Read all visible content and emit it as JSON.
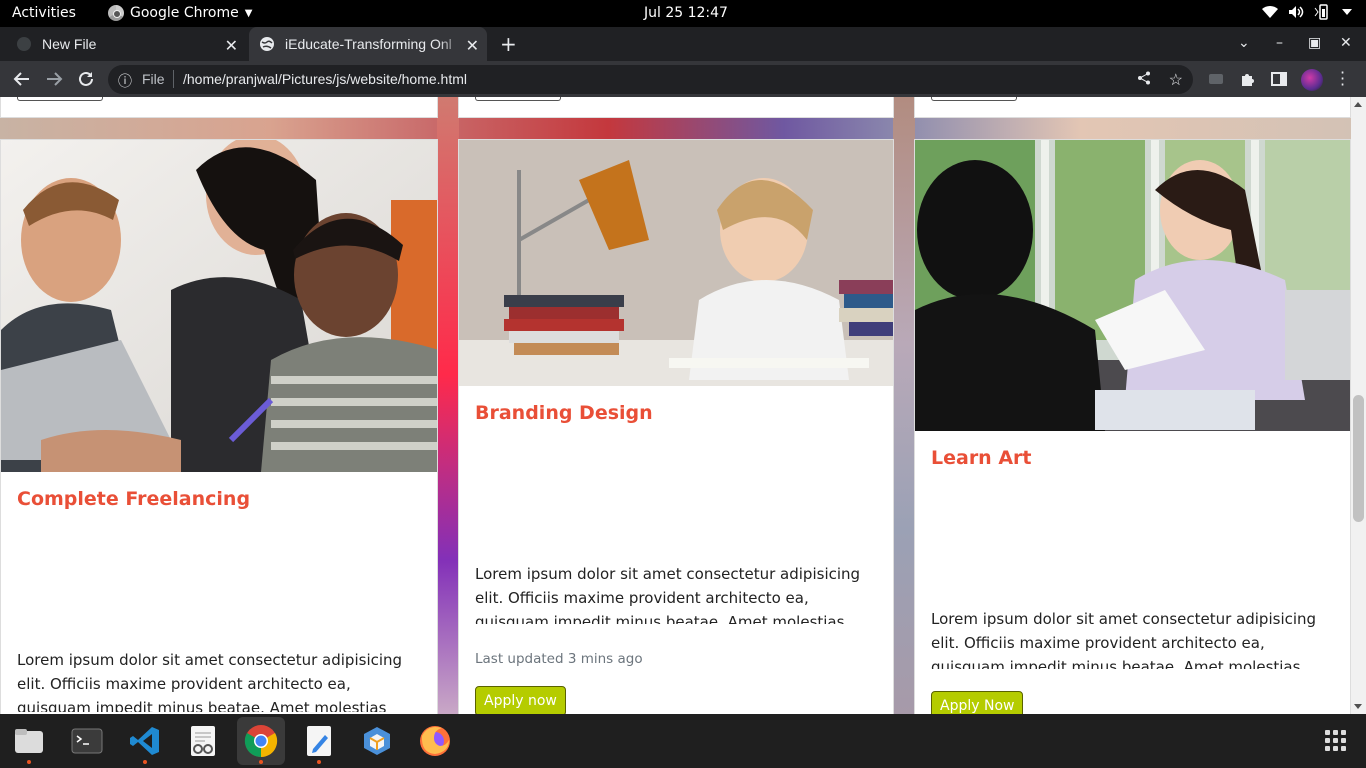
{
  "topbar": {
    "activities": "Activities",
    "app_name": "Google Chrome",
    "clock": "Jul 25  12:47"
  },
  "tabs": [
    {
      "label": "New File"
    },
    {
      "label": "iEducate-Transforming Onl"
    }
  ],
  "toolbar": {
    "file_label": "File",
    "url": "/home/pranjwal/Pictures/js/website/home.html"
  },
  "cards": [
    {
      "title": "Complete Freelancing",
      "body": "Lorem ipsum dolor sit amet consectetur adipisicing elit. Officiis maxime provident architecto ea, quisquam impedit minus beatae. Amet molestias architecto nemo"
    },
    {
      "title": "Branding Design",
      "body": "Lorem ipsum dolor sit amet consectetur adipisicing elit. Officiis maxime provident architecto ea, quisquam impedit minus beatae. Amet molestias architecto nemo",
      "updated": "Last updated 3 mins ago",
      "button": "Apply now"
    },
    {
      "title": "Learn Art",
      "body": "Lorem ipsum dolor sit amet consectetur adipisicing elit. Officiis maxime provident architecto ea, quisquam impedit minus beatae. Amet molestias architecto nemo",
      "button": "Apply Now"
    }
  ],
  "colors": {
    "accent_title": "#e94f37",
    "apply_button": "#b5cc00",
    "chrome_dark": "#202124",
    "chrome_toolbar": "#35363a"
  },
  "dock": {
    "items": [
      "files-icon",
      "terminal-icon",
      "vscode-icon",
      "text-viewer-icon",
      "chrome-icon",
      "text-editor-icon",
      "app-icon",
      "firefox-icon"
    ]
  }
}
